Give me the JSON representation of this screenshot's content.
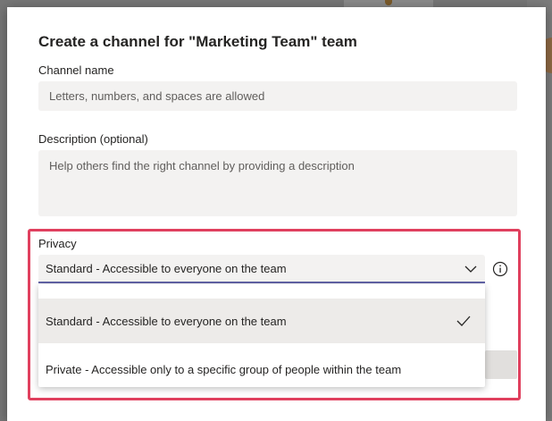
{
  "dialog": {
    "title": "Create a channel for \"Marketing Team\" team",
    "channel_name": {
      "label": "Channel name",
      "placeholder": "Letters, numbers, and spaces are allowed",
      "value": ""
    },
    "description": {
      "label": "Description (optional)",
      "placeholder": "Help others find the right channel by providing a description",
      "value": ""
    },
    "privacy": {
      "label": "Privacy",
      "selected": "Standard - Accessible to everyone on the team",
      "options": [
        {
          "label": "Standard - Accessible to everyone on the team",
          "selected": true
        },
        {
          "label": "Private - Accessible only to a specific group of people within the team",
          "selected": false
        }
      ]
    }
  },
  "colors": {
    "accent": "#6264a7",
    "highlight": "#e0405e",
    "field_bg": "#f3f2f1"
  },
  "icons": {
    "dropdown": "chevron-down-icon",
    "info": "info-icon",
    "selected": "checkmark-icon"
  }
}
